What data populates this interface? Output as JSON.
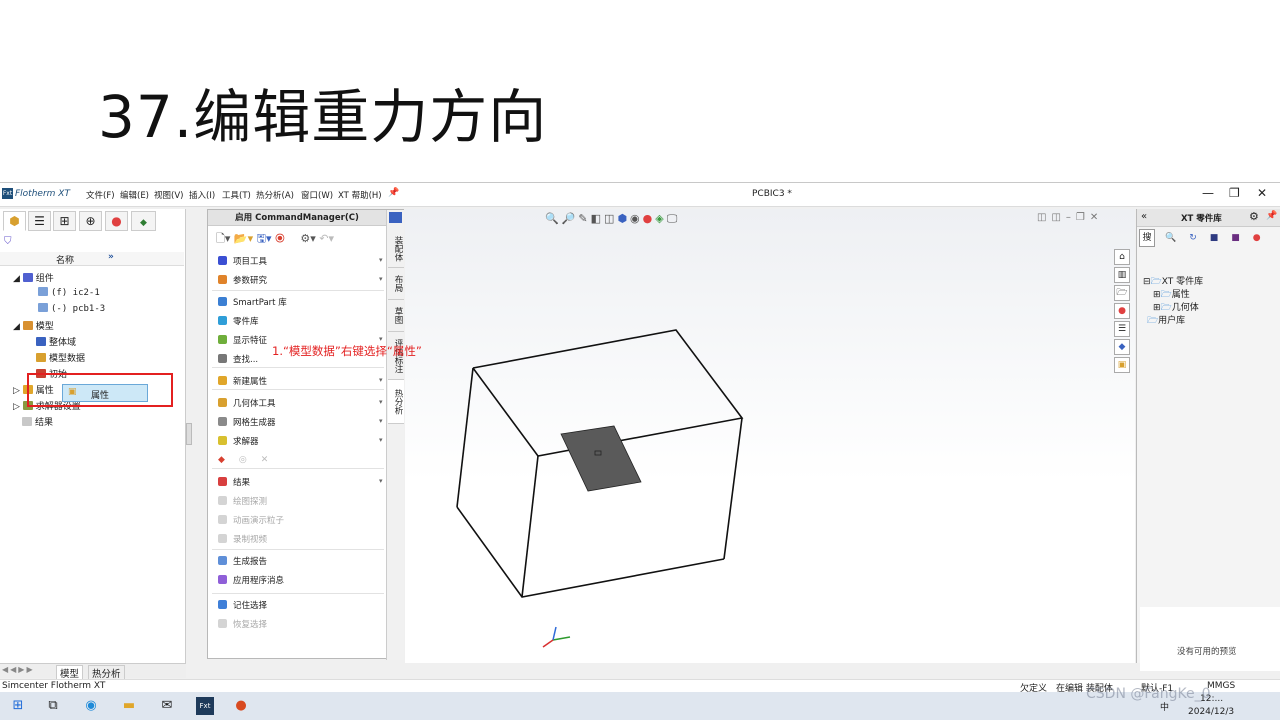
{
  "slide": {
    "title": "37.编辑重力方向"
  },
  "app": {
    "name": "Flotherm XT",
    "logo": "Fxt",
    "doc_title": "PCBIC3 *",
    "menu": [
      "文件(F)",
      "编辑(E)",
      "视图(V)",
      "插入(I)",
      "工具(T)",
      "热分析(A)",
      "窗口(W)",
      "XT 帮助(H)"
    ]
  },
  "left_panel": {
    "column_header": "名称",
    "expand": "»",
    "tree": {
      "components": "组件",
      "comp1": "(f) ic2-1",
      "comp2": "(-) pcb1-3",
      "model": "模型",
      "whole_domain": "整体域",
      "model_data": "模型数据",
      "init": "初始",
      "attributes": "属性",
      "solver_settings": "求解器设置",
      "results": "结果"
    },
    "context_menu": {
      "properties": "属性"
    },
    "bottom_tabs": [
      "模型",
      "热分析"
    ]
  },
  "command_manager": {
    "title": "启用 CommandManager(C)",
    "items": [
      {
        "label": "项目工具",
        "arrow": true,
        "color": "#3b4fd3"
      },
      {
        "label": "参数研究",
        "arrow": true,
        "color": "#e0832a"
      },
      {
        "label": "SmartPart 库",
        "arrow": false,
        "color": "#3b7fd3"
      },
      {
        "label": "零件库",
        "arrow": false,
        "color": "#2f9ed8"
      },
      {
        "label": "显示特征",
        "arrow": true,
        "color": "#6fae3b"
      },
      {
        "label": "查找...",
        "arrow": false,
        "color": "#777777"
      },
      {
        "label": "新建属性",
        "arrow": true,
        "color": "#e0a62a"
      },
      {
        "label": "几何体工具",
        "arrow": true,
        "color": "#d8a02f"
      },
      {
        "label": "网格生成器",
        "arrow": true,
        "color": "#8a8a8a"
      },
      {
        "label": "求解器",
        "arrow": true,
        "color": "#d8c02f"
      },
      {
        "label": "结果",
        "arrow": true,
        "color": "#d83f3f"
      },
      {
        "label": "绘图探测",
        "disabled": true
      },
      {
        "label": "动画演示粒子",
        "disabled": true
      },
      {
        "label": "录制视频",
        "disabled": true
      },
      {
        "label": "生成报告",
        "arrow": false,
        "color": "#5f8fd8"
      },
      {
        "label": "应用程序消息",
        "arrow": false,
        "color": "#8f5fd8"
      },
      {
        "label": "记住选择",
        "arrow": false,
        "color": "#3f7fd8"
      },
      {
        "label": "恢复选择",
        "disabled": true
      }
    ],
    "side_tabs": [
      "装配体",
      "布局",
      "草图",
      "评估标注",
      "热分析"
    ]
  },
  "viewport": {
    "annotation": "1.“模型数据”右键选择“属性”"
  },
  "right_panel": {
    "title": "XT 零件库",
    "collapse": "«",
    "tree": {
      "root": "XT 零件库",
      "attributes": "属性",
      "geometry": "几何体",
      "user_lib": "用户库"
    },
    "no_preview": "没有可用的预览"
  },
  "status_bar": {
    "left": "Simcenter Flotherm XT",
    "undef": "欠定义",
    "editing": "在编辑 装配体",
    "default": "默认-F1",
    "units": "MMGS"
  },
  "taskbar": {
    "lang": "中",
    "time": "12:...",
    "date": "2024/12/3",
    "watermark": "CSDN @FangKe_0"
  }
}
